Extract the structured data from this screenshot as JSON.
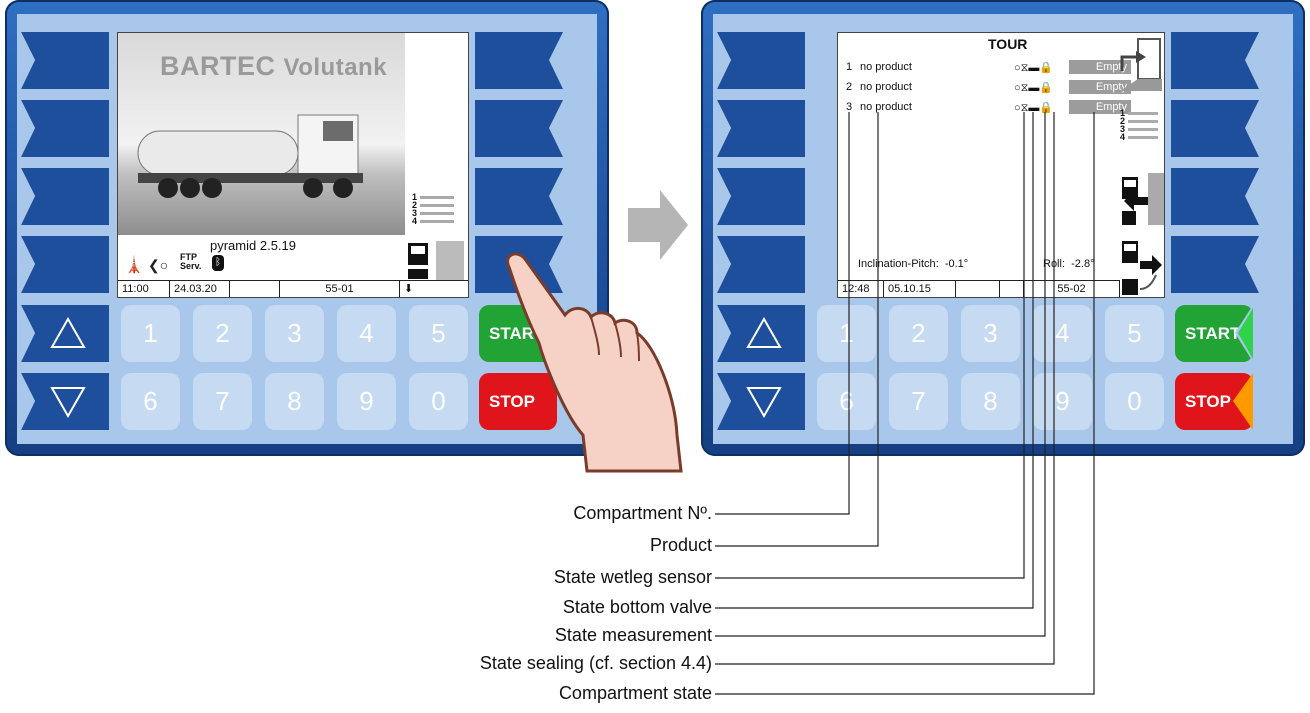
{
  "left_device": {
    "brand": "BARTEC",
    "brand_sub": "Volutank",
    "version": "pyramid 2.5.19",
    "ftp_label": "FTP",
    "serv_label": "Serv.",
    "time": "11:00",
    "date": "24.03.20",
    "id": "55-01",
    "list_numbers": [
      "1",
      "2",
      "3",
      "4"
    ]
  },
  "right_device": {
    "title": "TOUR",
    "compartments": [
      {
        "number": "1",
        "product": "no product",
        "icons": "○⧖▬🔒",
        "state": "Empty"
      },
      {
        "number": "2",
        "product": "no product",
        "icons": "○⧖▬🔒",
        "state": "Empty"
      },
      {
        "number": "3",
        "product": "no product",
        "icons": "○⧖▬🔒",
        "state": "Empty"
      }
    ],
    "inclination_label": "Inclination-Pitch:",
    "inclination_value": "-0.1°",
    "roll_label": "Roll:",
    "roll_value": "-2.8°",
    "time": "12:48",
    "date": "05.10.15",
    "id": "55-02",
    "list_numbers": [
      "1",
      "2",
      "3",
      "4"
    ]
  },
  "keypad": {
    "row1": [
      "1",
      "2",
      "3",
      "4",
      "5"
    ],
    "row2": [
      "6",
      "7",
      "8",
      "9",
      "0"
    ],
    "start_label": "START",
    "stop_label": "STOP"
  },
  "callouts": [
    "Compartment Nº.",
    "Product",
    "State wetleg sensor",
    "State bottom valve",
    "State measurement",
    "State sealing (cf. section 4.4)",
    "Compartment state"
  ],
  "colors": {
    "frame": "#1d4f9c",
    "panel": "#a9c7ea",
    "key_dark": "#1d4f9c",
    "start": "#21a336",
    "stop": "#e0141b",
    "state_bg": "#9c9c9c"
  }
}
